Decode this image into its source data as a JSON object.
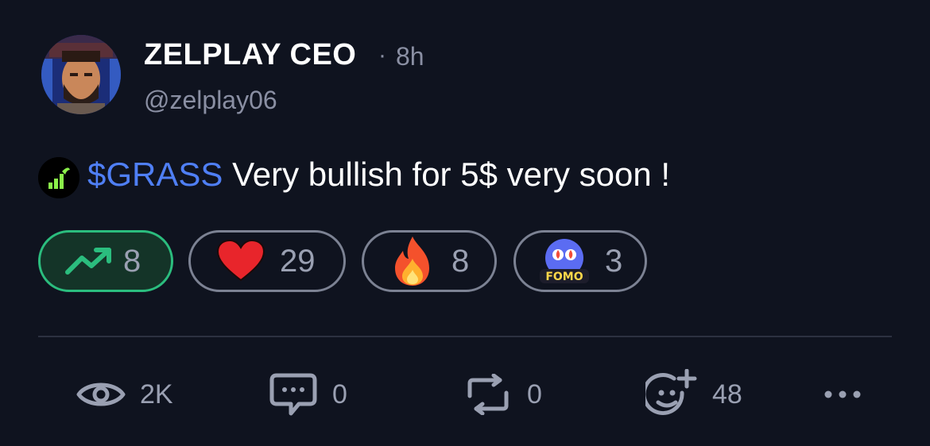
{
  "author": {
    "name": "ZELPLAY CEO",
    "separator": "·",
    "time": "8h",
    "handle": "@zelplay06",
    "avatar_icon": "avatar-portrait"
  },
  "post": {
    "token_icon": "grass-token-icon",
    "ticker": "$GRASS",
    "text": "Very bullish for 5$ very soon !"
  },
  "reactions": [
    {
      "icon": "trending-up-icon",
      "count": "8",
      "active": true
    },
    {
      "icon": "heart-icon",
      "count": "29",
      "active": false
    },
    {
      "icon": "fire-icon",
      "count": "8",
      "active": false
    },
    {
      "icon": "fomo-icon",
      "label": "FOMO",
      "count": "3",
      "active": false
    }
  ],
  "stats": {
    "views": "2K",
    "comments": "0",
    "reposts": "0",
    "reactions": "48"
  },
  "colors": {
    "background": "#0f131f",
    "ticker": "#4f7ff5",
    "active_border": "#2bbd7e",
    "muted": "#8a8fa3"
  }
}
